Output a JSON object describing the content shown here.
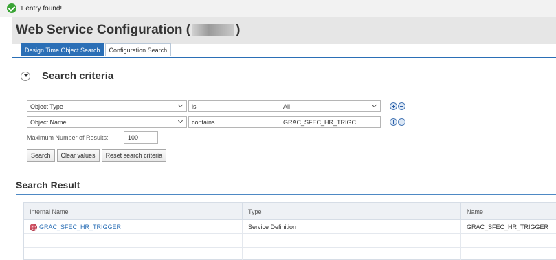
{
  "message": {
    "text": "1 entry found!",
    "icon": "success-check-icon"
  },
  "header": {
    "title_prefix": "Web Service Configuration (",
    "title_suffix": ")"
  },
  "tabs": [
    {
      "label": "Design Time Object Search",
      "active": true
    },
    {
      "label": "Configuration Search",
      "active": false
    }
  ],
  "search": {
    "section_title": "Search criteria",
    "rows": [
      {
        "field": "Object Type",
        "operator": "is",
        "value": "All"
      },
      {
        "field": "Object Name",
        "operator": "contains",
        "value": "GRAC_SFEC_HR_TRIGC"
      }
    ],
    "max_label": "Maximum Number of Results:",
    "max_value": "100",
    "buttons": {
      "search": "Search",
      "clear": "Clear values",
      "reset": "Reset search criteria"
    }
  },
  "results": {
    "title": "Search Result",
    "columns": [
      "Internal Name",
      "Type",
      "Name"
    ],
    "rows": [
      {
        "internal_name": "GRAC_SFEC_HR_TRIGGER",
        "type": "Service Definition",
        "name": "GRAC_SFEC_HR_TRIGGER"
      }
    ]
  },
  "colors": {
    "accent": "#2b6fb6",
    "success": "#3aa435"
  }
}
